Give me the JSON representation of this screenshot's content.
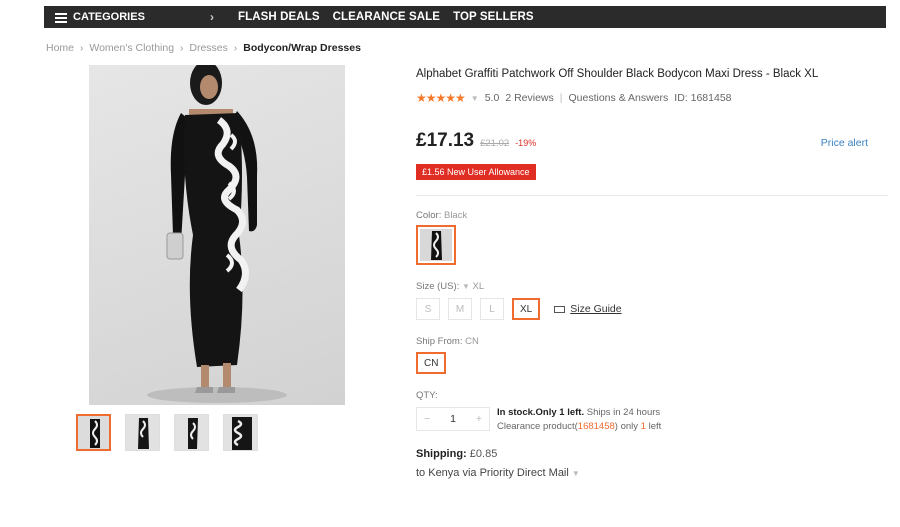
{
  "nav": {
    "categories_label": "CATEGORIES",
    "links": [
      "FLASH DEALS",
      "CLEARANCE SALE",
      "TOP SELLERS"
    ]
  },
  "breadcrumb": [
    "Home",
    "Women's Clothing",
    "Dresses",
    "Bodycon/Wrap Dresses"
  ],
  "product": {
    "title": "Alphabet Graffiti Patchwork Off Shoulder Black Bodycon Maxi Dress - Black XL",
    "stars": "★★★★★",
    "rating": "5.0",
    "reviews": "2 Reviews",
    "questions": "Questions & Answers",
    "id_label": "ID: 1681458",
    "price": "£17.13",
    "old_price": "£21.02",
    "discount": "-19%",
    "price_alert": "Price alert",
    "allowance": "£1.56 New User Allowance"
  },
  "options": {
    "color_label": "Color:",
    "color_value": "Black",
    "size_label": "Size (US):",
    "size_value": "XL",
    "sizes": [
      "S",
      "M",
      "L",
      "XL"
    ],
    "selected_size": "XL",
    "size_guide": "Size Guide",
    "ship_label": "Ship From:",
    "ship_value": "CN",
    "ship_option": "CN"
  },
  "qty": {
    "label": "QTY:",
    "minus": "−",
    "value": "1",
    "plus": "+",
    "stock_bold": "In stock.Only 1 left.",
    "stock_rest": " Ships in 24 hours",
    "clearance_prefix": "Clearance product(",
    "clearance_id": "1681458",
    "clearance_mid": ") only ",
    "clearance_count": "1",
    "clearance_suffix": " left"
  },
  "shipping": {
    "label": "Shipping:",
    "cost": "£0.85",
    "method": "to Kenya via Priority Direct Mail"
  },
  "colors": {
    "accent": "#f06b30",
    "sale_red": "#e02e24",
    "link_blue": "#3b82c4",
    "nav_bg": "#2b2b2b",
    "star": "#f5792b"
  }
}
